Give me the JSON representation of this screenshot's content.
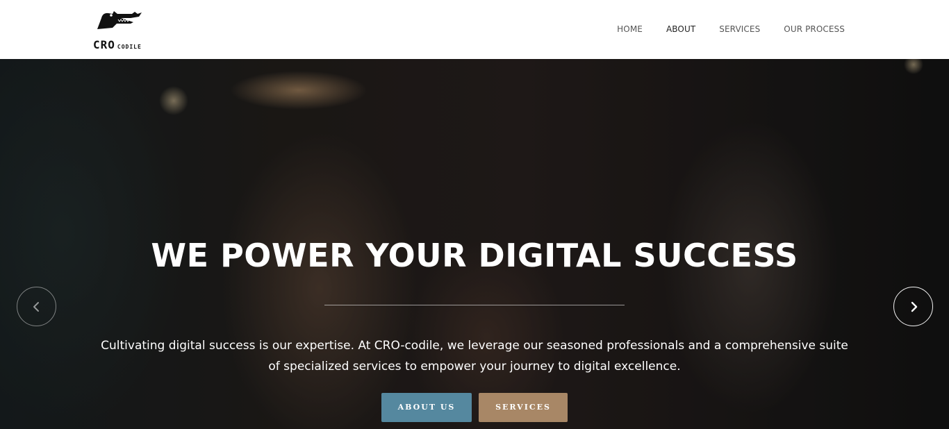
{
  "brand": {
    "name_main": "CRO",
    "name_sub": "CODILE",
    "icon": "crocodile-logo"
  },
  "nav": {
    "items": [
      {
        "label": "HOME",
        "active": false
      },
      {
        "label": "ABOUT",
        "active": true
      },
      {
        "label": "SERVICES",
        "active": false
      },
      {
        "label": "OUR PROCESS",
        "active": false
      }
    ]
  },
  "hero": {
    "title": "WE POWER YOUR DIGITAL SUCCESS",
    "text": "Cultivating digital success is our expertise. At CRO-codile, we leverage our seasoned professionals and a comprehensive suite of specialized services to empower your journey to digital excellence.",
    "buttons": {
      "about": "ABOUT US",
      "services": "SERVICES"
    },
    "prev_icon": "chevron-left-icon",
    "next_icon": "chevron-right-icon"
  },
  "colors": {
    "about_button": "#55889f",
    "services_button": "#a88766",
    "header_bg": "#ffffff"
  }
}
